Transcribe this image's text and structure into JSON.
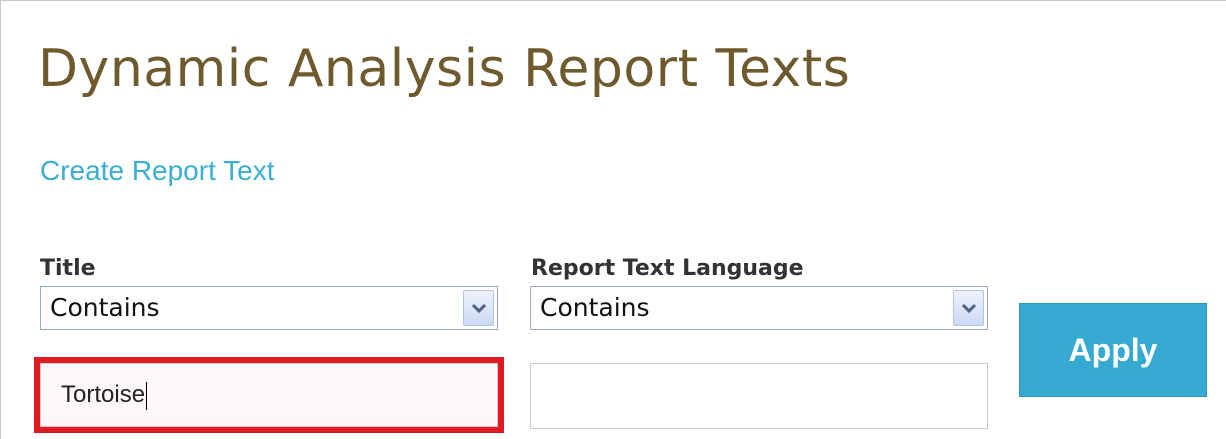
{
  "page": {
    "title": "Dynamic Analysis Report Texts",
    "create_link": "Create Report Text"
  },
  "filters": {
    "title_label": "Title",
    "title_operator": "Contains",
    "title_value": "Tortoise",
    "language_label": "Report Text Language",
    "language_operator": "Contains",
    "language_value": ""
  },
  "actions": {
    "apply_label": "Apply"
  },
  "colors": {
    "title": "#6f5a2e",
    "link": "#3aaed3",
    "apply_button": "#35a9d2",
    "highlight": "#e11b24"
  },
  "icons": {
    "dropdown": "chevron-down-icon"
  }
}
